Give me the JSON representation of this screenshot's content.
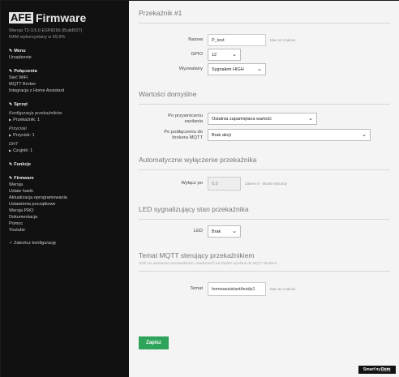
{
  "logo": {
    "afe": "AFE",
    "firmware": "Firmware"
  },
  "version_line1": "Wersja T2-3.5.0 ESP8266 (Build507)",
  "version_line2": "RAM wykorzystany w 69,9%",
  "nav": {
    "menu": {
      "title": "Menu",
      "items": [
        "Urządzenie"
      ]
    },
    "connections": {
      "title": "Połączenia",
      "items": [
        "Sieć WiFi",
        "MQTT Broker",
        "Integracja z Home Assistant"
      ]
    },
    "hardware": {
      "title": "Sprzęt",
      "relays_config": "Konfiguracja przekaźników",
      "relay1": "Przekaźnik: 1",
      "buttons": "Przyciski",
      "button1": "Przycisk: 1",
      "dht": "DHT",
      "sensor1": "Czujnik: 1"
    },
    "functions": {
      "title": "Funkcje"
    },
    "firmware": {
      "title": "Firmware",
      "items": [
        "Wersja",
        "Ustaw hasło",
        "Aktualizacja oprogramowania",
        "Ustawienia początkowe",
        "Wersja PRO",
        "Dokumentacja",
        "Pomoc",
        "Youtube"
      ]
    },
    "finish": "Zakończ konfigurację"
  },
  "page_title": "Przekaźnik #1",
  "fields": {
    "name_label": "Nazwa",
    "name_value": "P_test",
    "name_hint": "Max 16 znaków",
    "gpio_label": "GPIO",
    "gpio_value": "12",
    "triggered_label": "Wyzwalany",
    "triggered_value": "Sygnałem HIGH"
  },
  "defaults": {
    "title": "Wartości domyślne",
    "power_label_1": "Po przywróceniu",
    "power_label_2": "zasilania",
    "power_value": "Ostatnia zapamiętana wartość",
    "mqtt_label_1": "Po podłączeniu do",
    "mqtt_label_2": "brokera MQTT",
    "mqtt_value": "Brak akcji"
  },
  "auto_off": {
    "title": "Automatyczne wyłączenie przekaźnika",
    "label": "Wyłącz po",
    "value": "0,0",
    "hint": "Zakres 0 - 86400 sekundy"
  },
  "led": {
    "title": "LED sygnalizujący stan przekaźnika",
    "label": "LED",
    "value": "Brak"
  },
  "mqtt_topic": {
    "title": "Temat MQTT sterujący przekaźnikiem",
    "description": "Jeśli nie ustawione wprowadzenie, wiadomości nie będzie wysłane do MQTT Brokera",
    "label": "Temat",
    "value": "homeassistant/test/p1",
    "hint": "Max 64 znaków"
  },
  "save_label": "Zapisz",
  "brand": {
    "part1": "Smart'ny",
    "part2": "Dom"
  },
  "colors": {
    "save": "#2ea35a",
    "sidebar": "#111111",
    "content": "#f4f4f4"
  }
}
